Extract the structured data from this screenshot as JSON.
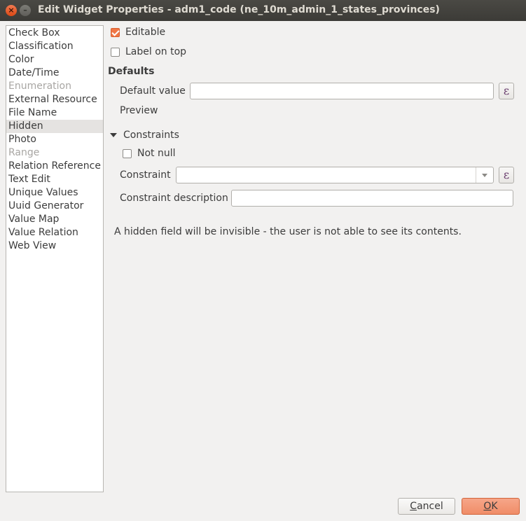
{
  "window": {
    "title": "Edit Widget Properties - adm1_code (ne_10m_admin_1_states_provinces)",
    "close_glyph": "×",
    "minimize_glyph": "–"
  },
  "sidebar": {
    "items": [
      {
        "label": "Check Box",
        "state": "normal"
      },
      {
        "label": "Classification",
        "state": "normal"
      },
      {
        "label": "Color",
        "state": "normal"
      },
      {
        "label": "Date/Time",
        "state": "normal"
      },
      {
        "label": "Enumeration",
        "state": "disabled"
      },
      {
        "label": "External Resource",
        "state": "normal"
      },
      {
        "label": "File Name",
        "state": "normal"
      },
      {
        "label": "Hidden",
        "state": "selected"
      },
      {
        "label": "Photo",
        "state": "normal"
      },
      {
        "label": "Range",
        "state": "disabled"
      },
      {
        "label": "Relation Reference",
        "state": "normal"
      },
      {
        "label": "Text Edit",
        "state": "normal"
      },
      {
        "label": "Unique Values",
        "state": "normal"
      },
      {
        "label": "Uuid Generator",
        "state": "normal"
      },
      {
        "label": "Value Map",
        "state": "normal"
      },
      {
        "label": "Value Relation",
        "state": "normal"
      },
      {
        "label": "Web View",
        "state": "normal"
      }
    ]
  },
  "settings": {
    "editable_label": "Editable",
    "editable_checked": true,
    "label_on_top_label": "Label on top",
    "label_on_top_checked": false
  },
  "defaults": {
    "heading": "Defaults",
    "default_value_label": "Default value",
    "default_value": "",
    "expression_glyph": "ε",
    "preview_label": "Preview"
  },
  "constraints": {
    "heading": "Constraints",
    "not_null_label": "Not null",
    "not_null_checked": false,
    "constraint_label": "Constraint",
    "constraint_value": "",
    "expression_glyph": "ε",
    "description_label": "Constraint description",
    "description_value": ""
  },
  "info_text": "A hidden field will be invisible - the user is not able to see its contents.",
  "buttons": {
    "cancel_mnemonic": "C",
    "cancel_rest": "ancel",
    "ok_mnemonic": "O",
    "ok_rest": "K"
  },
  "colors": {
    "accent": "#f07746",
    "ok_button": "#f08d68",
    "titlebar": "#3c3b37",
    "background": "#f2f1f0"
  }
}
